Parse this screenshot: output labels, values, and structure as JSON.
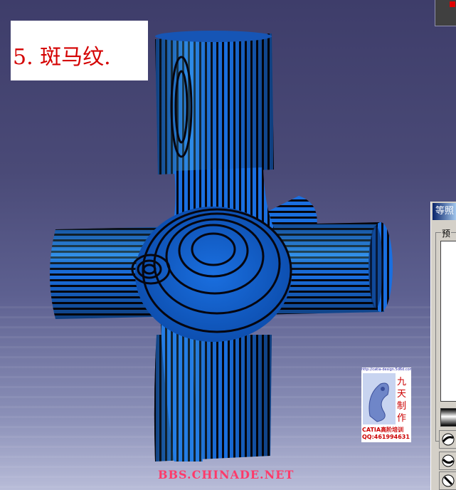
{
  "caption": {
    "text": "5. 斑马纹."
  },
  "panel": {
    "title": "等照",
    "group_label": "预"
  },
  "watermark": {
    "url": "http://catia-design.5d6d.com",
    "chars": [
      "九",
      "天",
      "制",
      "作"
    ],
    "catia": "CATIA高阶培训",
    "qq": "QQ:461994631"
  },
  "footer": {
    "site": "BBS.CHINADE.NET"
  },
  "colors": {
    "background_top": "#3e3d6a",
    "model_blue": "#1a6fe0",
    "stripe_dark": "#06060f",
    "caption_red": "#d40000",
    "footer_pink": "#ff3a6a"
  },
  "icons": [
    "sphere-view-icon",
    "sphere-view-icon-2",
    "sphere-view-icon-3"
  ]
}
